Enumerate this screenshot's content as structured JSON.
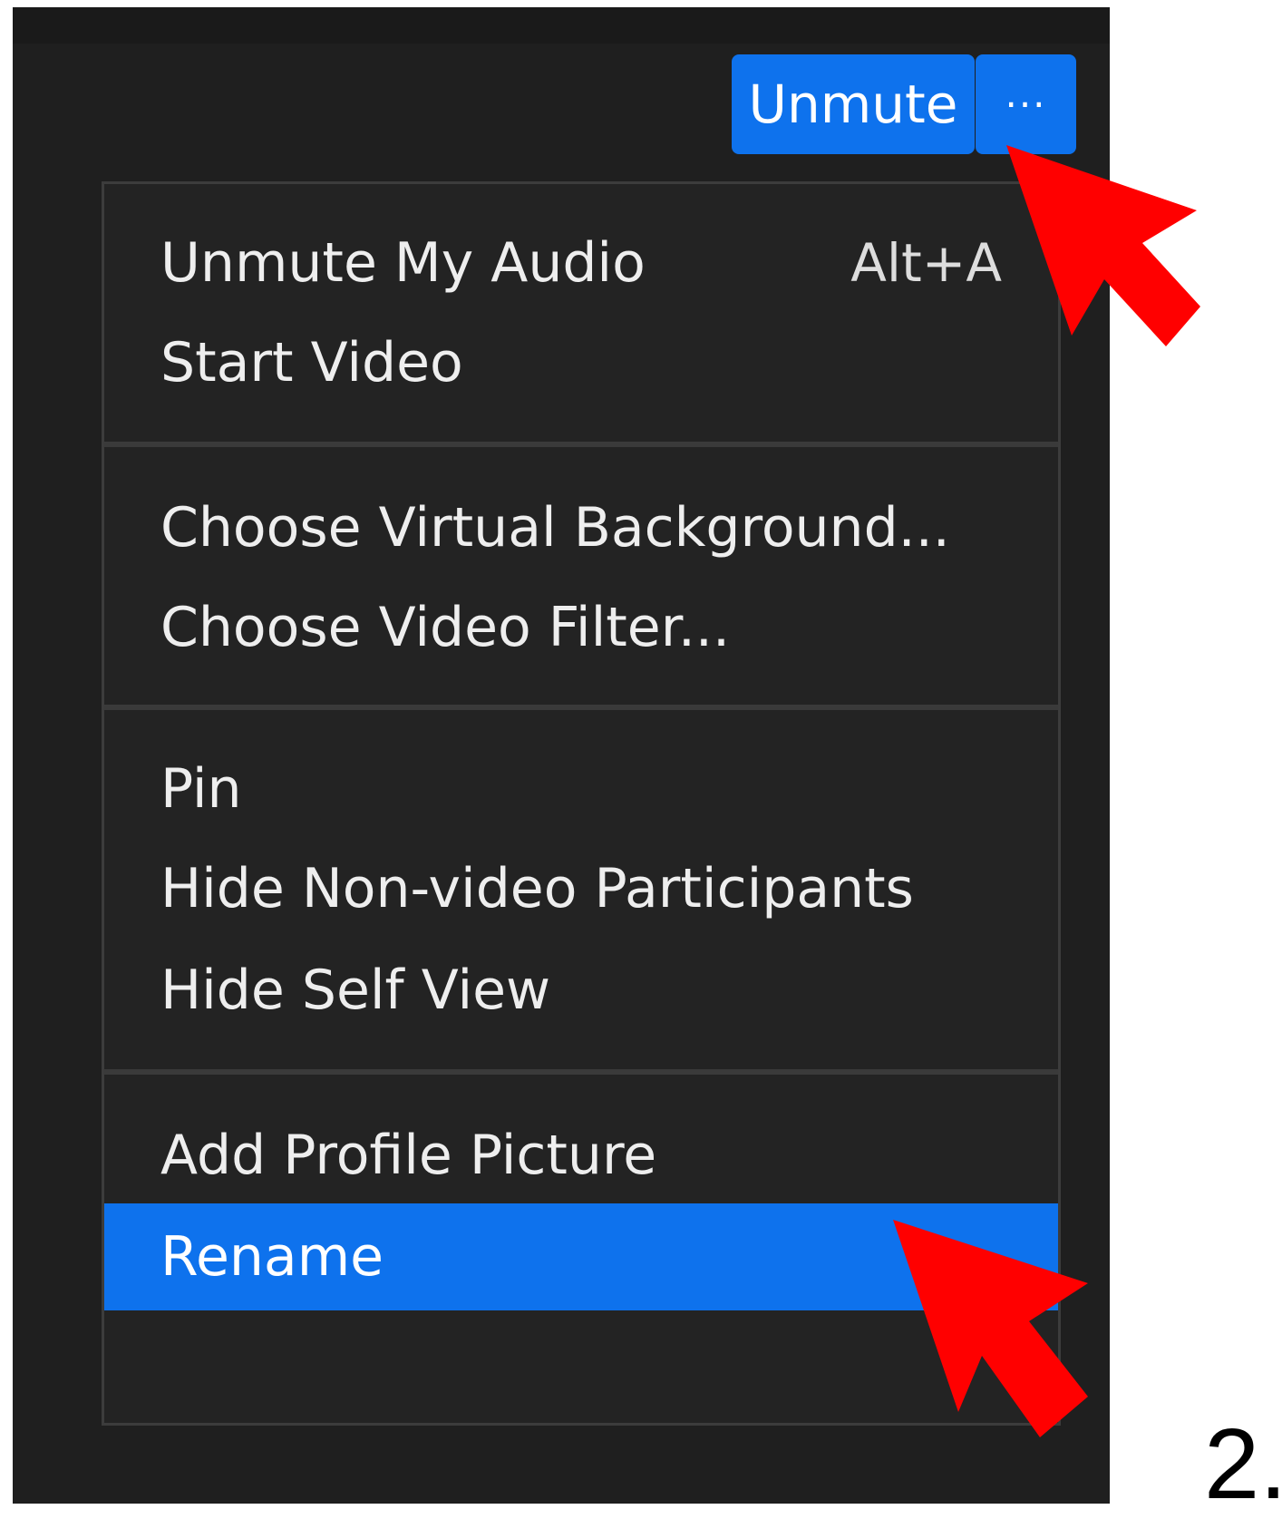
{
  "toolbar": {
    "unmute_label": "Unmute",
    "more_label": "···"
  },
  "menu": {
    "groups": [
      {
        "items": [
          {
            "label": "Unmute My Audio",
            "shortcut": "Alt+A"
          },
          {
            "label": "Start Video",
            "shortcut": ""
          }
        ]
      },
      {
        "items": [
          {
            "label": "Choose Virtual Background...",
            "shortcut": ""
          },
          {
            "label": "Choose Video Filter...",
            "shortcut": ""
          }
        ]
      },
      {
        "items": [
          {
            "label": "Pin",
            "shortcut": ""
          },
          {
            "label": "Hide Non-video Participants",
            "shortcut": ""
          },
          {
            "label": "Hide Self View",
            "shortcut": ""
          }
        ]
      },
      {
        "items": [
          {
            "label": "Add Profile Picture",
            "shortcut": ""
          },
          {
            "label": "Rename",
            "shortcut": "",
            "selected": true
          }
        ]
      }
    ]
  },
  "annotation": {
    "step_label": "2."
  },
  "colors": {
    "accent": "#0e72ed",
    "arrow": "#ff0000",
    "menu_bg": "#232323",
    "window_bg": "#1f1f1f"
  }
}
